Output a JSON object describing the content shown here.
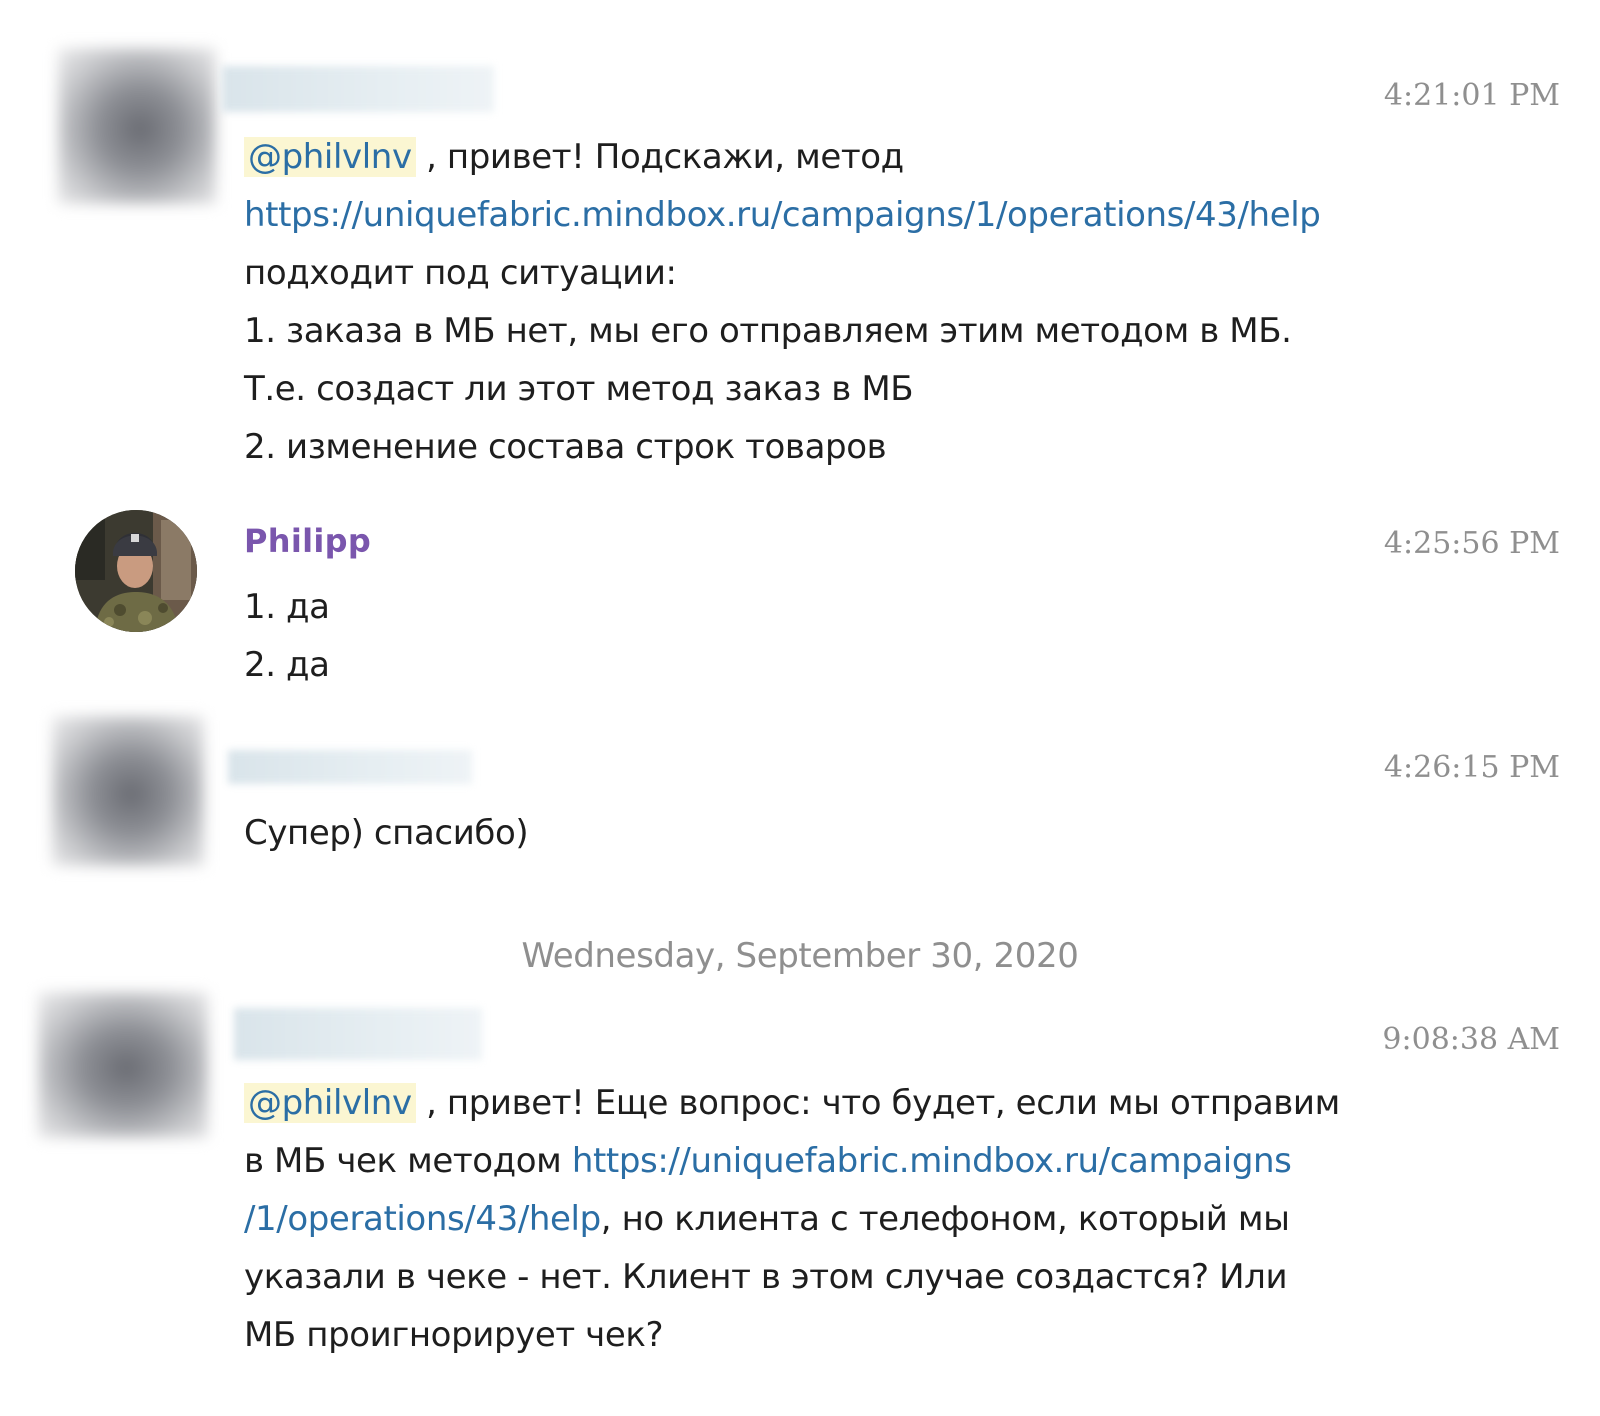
{
  "messages": [
    {
      "time": "4:21:01 PM",
      "mention": "@philvlnv",
      "line1_rest": " , привет! Подскажи, метод",
      "link": "https://uniquefabric.mindbox.ru/campaigns/1/operations/43/help",
      "line3": "подходит под ситуации:",
      "line4": "1. заказа в МБ нет, мы его отправляем этим методом в МБ.",
      "line5": "Т.е. создаст ли этот метод заказ в МБ",
      "line6": "2. изменение состава строк товаров"
    },
    {
      "sender": "Philipp",
      "time": "4:25:56 PM",
      "line1": "1. да",
      "line2": "2. да"
    },
    {
      "time": "4:26:15 PM",
      "line1": "Супер) спасибо)"
    },
    {
      "time": "9:08:38 AM",
      "mention": "@philvlnv",
      "line1_rest": " , привет! Еще вопрос: что будет, если мы отправим",
      "line2_pre": "в МБ чек методом ",
      "link_part1": "https://uniquefabric.mindbox.ru/campaigns",
      "link_part2": "/1/operations/43/help",
      "line3_rest": ", но клиента с телефоном, который мы",
      "line4": "указали в чеке  - нет. Клиент в этом случае создастся? Или",
      "line5": "МБ проигнорирует чек?"
    }
  ],
  "date_separator": "Wednesday, September 30, 2020",
  "colors": {
    "link": "#2b6ea5",
    "mention_bg": "#fbf6d2",
    "sender_name": "#7a56ad",
    "timestamp": "#8f8f8f"
  }
}
